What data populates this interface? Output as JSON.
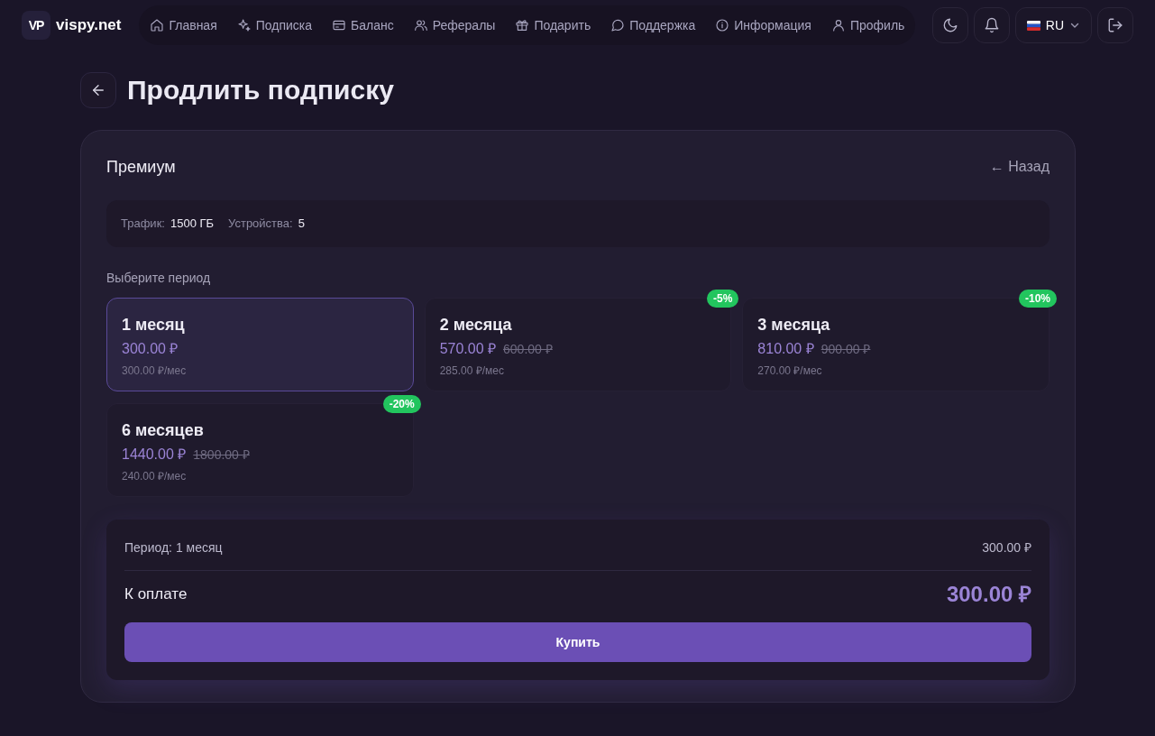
{
  "header": {
    "logo_mark": "VP",
    "logo_text": "vispy.net",
    "nav": [
      {
        "label": "Главная"
      },
      {
        "label": "Подписка"
      },
      {
        "label": "Баланс"
      },
      {
        "label": "Рефералы"
      },
      {
        "label": "Подарить"
      },
      {
        "label": "Поддержка"
      },
      {
        "label": "Информация"
      },
      {
        "label": "Профиль"
      }
    ],
    "language": "RU"
  },
  "page": {
    "title": "Продлить подписку"
  },
  "plan": {
    "name": "Премиум",
    "back_link": "← Назад",
    "stats": [
      {
        "label": "Трафик:",
        "value": "1500 ГБ"
      },
      {
        "label": "Устройства:",
        "value": "5"
      }
    ],
    "period_label": "Выберите период"
  },
  "periods": [
    {
      "name": "1 месяц",
      "price": "300.00 ₽",
      "per_month": "300.00 ₽/мес",
      "selected": true
    },
    {
      "name": "2 месяца",
      "price": "570.00 ₽",
      "old_price": "600.00 ₽",
      "per_month": "285.00 ₽/мес",
      "badge": "-5%",
      "selected": false
    },
    {
      "name": "3 месяца",
      "price": "810.00 ₽",
      "old_price": "900.00 ₽",
      "per_month": "270.00 ₽/мес",
      "badge": "-10%",
      "selected": false
    },
    {
      "name": "6 месяцев",
      "price": "1440.00 ₽",
      "old_price": "1800.00 ₽",
      "per_month": "240.00 ₽/мес",
      "badge": "-20%",
      "selected": false
    }
  ],
  "summary": {
    "period_text": "Период: 1 месяц",
    "period_amount": "300.00 ₽",
    "total_label": "К оплате",
    "total_amount": "300.00 ₽",
    "buy_button": "Купить"
  }
}
